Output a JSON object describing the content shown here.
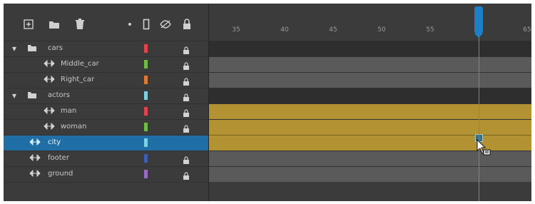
{
  "toolbar": {
    "icons": [
      "new-layer-icon",
      "new-folder-icon",
      "delete-icon",
      "dot-icon",
      "outline-icon",
      "eye-off-icon",
      "lock-icon"
    ]
  },
  "ruler": {
    "ticks": [
      "35",
      "40",
      "45",
      "50",
      "55",
      "",
      "65"
    ]
  },
  "layers": [
    {
      "name": "cars",
      "type": "folder",
      "color": "#e0454a",
      "locked": true
    },
    {
      "name": "Middle_car",
      "type": "layer",
      "color": "#6fbe44",
      "locked": true
    },
    {
      "name": "Right_car",
      "type": "layer",
      "color": "#e07a2e",
      "locked": true
    },
    {
      "name": "actors",
      "type": "folder",
      "color": "#7fd0e2",
      "locked": true
    },
    {
      "name": "man",
      "type": "layer",
      "color": "#e0454a",
      "locked": true
    },
    {
      "name": "woman",
      "type": "layer",
      "color": "#6fbe44",
      "locked": true
    },
    {
      "name": "city",
      "type": "layer",
      "color": "#7fd0e2",
      "locked": false,
      "selected": true
    },
    {
      "name": "footer",
      "type": "layer",
      "color": "#3d5fb3",
      "locked": true
    },
    {
      "name": "ground",
      "type": "layer",
      "color": "#9a6ac3",
      "locked": true
    }
  ]
}
